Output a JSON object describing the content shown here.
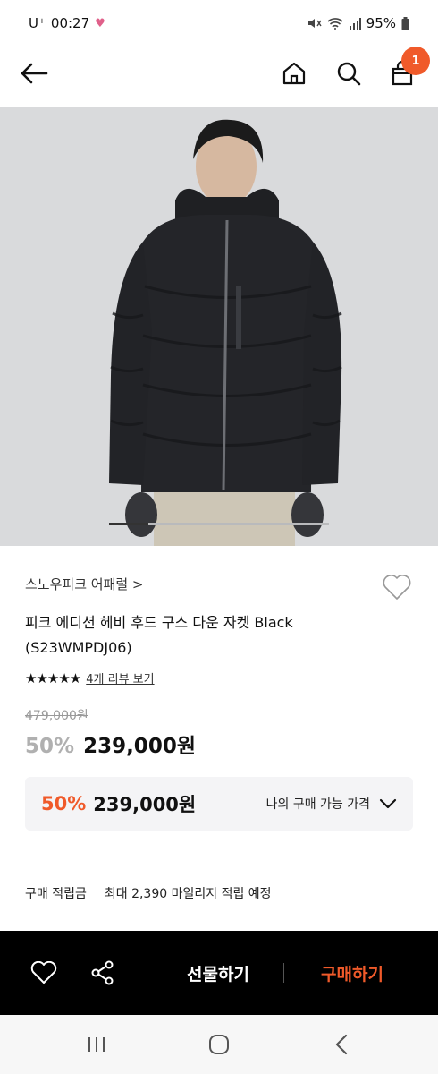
{
  "status": {
    "carrier": "U⁺",
    "time": "00:27",
    "battery": "95%"
  },
  "header": {
    "cart_count": "1"
  },
  "product": {
    "brand": "스노우피크 어패럴 >",
    "name": "피크 에디션 헤비 후드 구스 다운 자켓 Black (S23WMPDJ06)",
    "stars": "★★★★★",
    "rating": 5,
    "review_link": "4개 리뷰 보기",
    "original_price": "479,000원",
    "discount_pct": "50%",
    "sale_price": "239,000원"
  },
  "my_price": {
    "discount_pct": "50%",
    "price": "239,000원",
    "label": "나의 구매 가능 가격"
  },
  "points": {
    "label": "구매 적립금",
    "value": "최대 2,390 마일리지 적립 예정"
  },
  "bottom_bar": {
    "gift_label": "선물하기",
    "buy_label": "구매하기"
  },
  "colors": {
    "accent": "#f05a2a",
    "bottom_bar_bg": "#000000",
    "price_box_bg": "#f4f4f6"
  },
  "icons": {
    "back": "arrow-left-icon",
    "home": "home-icon",
    "search": "search-icon",
    "cart": "shopping-bag-icon",
    "wish": "heart-icon",
    "share": "share-icon",
    "expand": "chevron-down-icon"
  }
}
